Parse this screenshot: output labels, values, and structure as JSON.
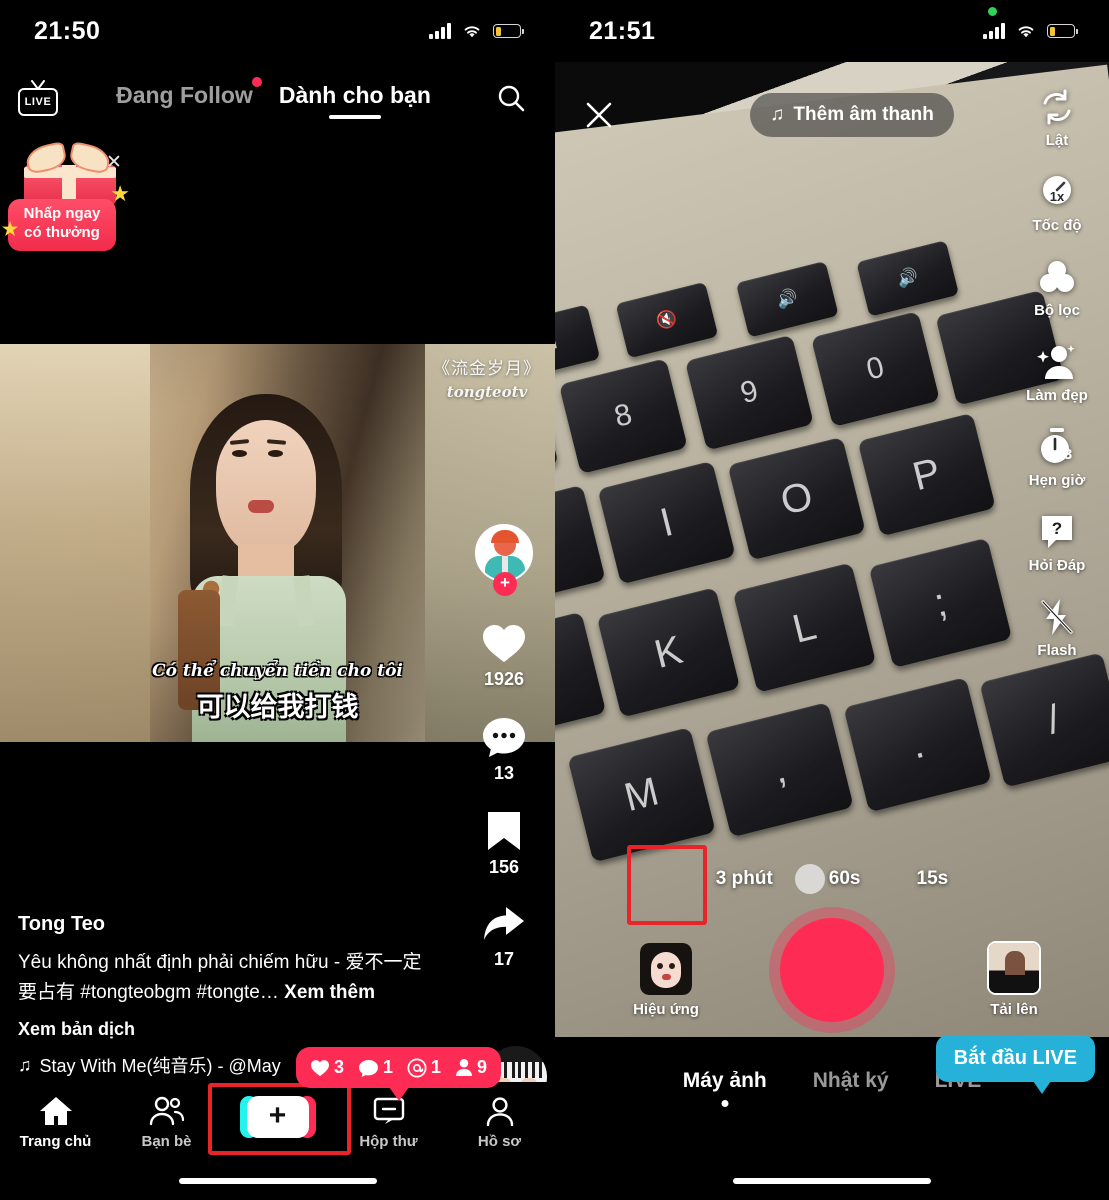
{
  "left": {
    "status": {
      "time": "21:50",
      "signal_icon": "signal-bars-icon",
      "wifi_icon": "wifi-icon",
      "battery_icon": "battery-low-icon"
    },
    "header": {
      "live_icon": "live-tv-icon",
      "live_text": "LIVE",
      "tabs": [
        {
          "label": "Đang Follow",
          "active": false,
          "has_dot": true
        },
        {
          "label": "Dành cho bạn",
          "active": true,
          "has_dot": false
        }
      ],
      "search_icon": "search-icon"
    },
    "gift_banner": {
      "line1": "Nhấp ngay",
      "line2": "có thưởng",
      "close_icon": "close-icon",
      "gift_icon": "gift-box-icon"
    },
    "video": {
      "watermark_title": "《流金岁月》",
      "watermark_user": "tongteotv",
      "subtitle_vi": "Có thể chuyển tiền cho tôi",
      "subtitle_cn": "可以给我打钱"
    },
    "rail": {
      "follow_plus": "+",
      "like_count": "1926",
      "comment_count": "13",
      "bookmark_count": "156",
      "share_count": "17"
    },
    "caption": {
      "username": "Tong Teo",
      "text": "Yêu không nhất định phải chiếm hữu - 爱不一定要占有 #tongteobgm #tongte…",
      "more": "Xem thêm",
      "translate": "Xem bản dịch",
      "music_note": "♫",
      "music": "Stay With Me(纯音乐) - @May"
    },
    "pink_tooltip": {
      "items": [
        {
          "icon": "heart-icon",
          "value": "3"
        },
        {
          "icon": "comment-icon",
          "value": "1"
        },
        {
          "icon": "mention-icon",
          "value": "1"
        },
        {
          "icon": "person-icon",
          "value": "9"
        }
      ]
    },
    "nav": [
      {
        "label": "Trang chủ",
        "icon": "home-icon",
        "active": true
      },
      {
        "label": "Bạn bè",
        "icon": "friends-icon",
        "active": false
      },
      {
        "label": "",
        "icon": "create-plus-icon",
        "active": false,
        "highlighted": true
      },
      {
        "label": "Hộp thư",
        "icon": "inbox-icon",
        "active": false
      },
      {
        "label": "Hồ sơ",
        "icon": "profile-icon",
        "active": false
      }
    ]
  },
  "right": {
    "status": {
      "time": "21:51",
      "rec_dot": "recording-dot-icon",
      "signal_icon": "signal-bars-icon",
      "wifi_icon": "wifi-icon",
      "battery_icon": "battery-low-icon"
    },
    "top": {
      "close_icon": "close-icon",
      "sound_label": "Thêm âm thanh",
      "sound_icon": "music-note-icon"
    },
    "tools": [
      {
        "label": "Lật",
        "icon": "flip-camera-icon"
      },
      {
        "label": "Tốc độ",
        "icon": "speed-icon",
        "badge": "1x"
      },
      {
        "label": "Bộ lọc",
        "icon": "filter-icon"
      },
      {
        "label": "Làm đẹp",
        "icon": "beautify-icon"
      },
      {
        "label": "Hẹn giờ",
        "icon": "timer-icon",
        "badge": "3"
      },
      {
        "label": "Hỏi Đáp",
        "icon": "qa-icon",
        "badge": "?"
      },
      {
        "label": "Flash",
        "icon": "flash-off-icon"
      }
    ],
    "durations": [
      {
        "label": "3 phút",
        "selected": false
      },
      {
        "label": "60s",
        "selected": false
      },
      {
        "label": "15s",
        "selected": true
      }
    ],
    "shutter": {
      "icon": "record-button-icon"
    },
    "effects": {
      "label": "Hiệu ứng",
      "icon": "effects-thumbnail-icon",
      "highlighted": true
    },
    "upload": {
      "label": "Tải lên",
      "icon": "upload-thumbnail-icon"
    },
    "modes": [
      {
        "label": "Máy ảnh",
        "active": true
      },
      {
        "label": "Nhật ký",
        "active": false
      },
      {
        "label": "LIVE",
        "active": false
      }
    ],
    "live_tooltip": "Bắt đầu LIVE"
  },
  "colors": {
    "accent_pink": "#fe2c55",
    "accent_cyan": "#25f4ee",
    "highlight_red": "#e8232a",
    "tooltip_blue": "#26b2d8",
    "battery_yellow": "#f2c438",
    "rec_green": "#30d158"
  }
}
